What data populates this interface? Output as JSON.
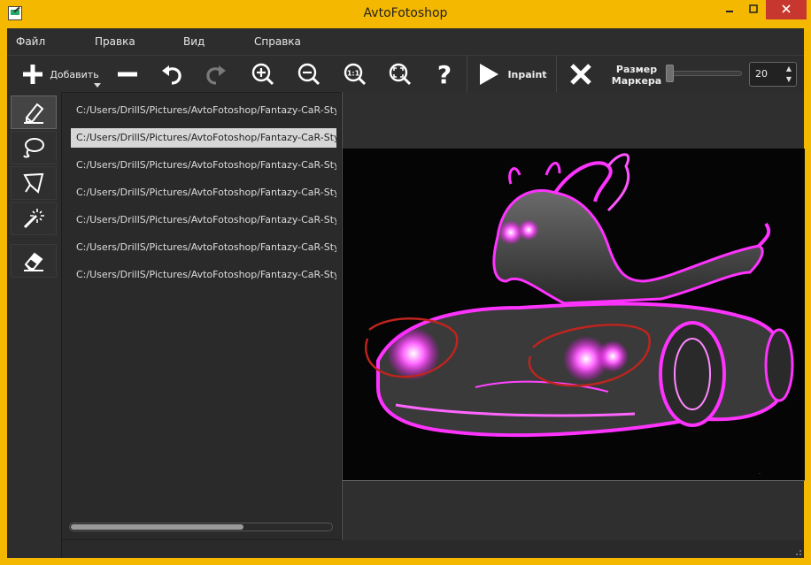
{
  "window": {
    "title": "AvtoFotoshop",
    "minimize_icon": "minimize-icon",
    "maximize_icon": "maximize-icon",
    "close_icon": "close-icon",
    "close_color": "#c7372f",
    "frame_color": "#f5b800"
  },
  "menu": {
    "items": [
      "Файл",
      "Правка",
      "Вид",
      "Справка"
    ]
  },
  "toolbar": {
    "add_label": "Добавить",
    "inpaint_label": "Inpaint",
    "marker_size_label_1": "Размер",
    "marker_size_label_2": "Маркера",
    "marker_size_value": "20",
    "icons": [
      "plus-icon",
      "minus-icon",
      "undo-icon",
      "redo-icon",
      "zoom-in-icon",
      "zoom-out-icon",
      "zoom-actual-icon",
      "zoom-fit-icon",
      "help-icon",
      "play-icon",
      "close-x-icon"
    ]
  },
  "tools": {
    "items": [
      "marker-icon",
      "lasso-icon",
      "polygon-lasso-icon",
      "magic-wand-icon",
      "eraser-icon"
    ],
    "active_index": 0
  },
  "files": {
    "items": [
      "C:/Users/DrillS/Pictures/AvtoFotoshop/Fantazy-CaR-Sty",
      "C:/Users/DrillS/Pictures/AvtoFotoshop/Fantazy-CaR-Sty",
      "C:/Users/DrillS/Pictures/AvtoFotoshop/Fantazy-CaR-Sty",
      "C:/Users/DrillS/Pictures/AvtoFotoshop/Fantazy-CaR-Sty",
      "C:/Users/DrillS/Pictures/AvtoFotoshop/Fantazy-CaR-Sty",
      "C:/Users/DrillS/Pictures/AvtoFotoshop/Fantazy-CaR-Sty",
      "C:/Users/DrillS/Pictures/AvtoFotoshop/Fantazy-CaR-Sty"
    ],
    "selected_index": 1
  },
  "canvas": {
    "accent_color": "#ff33ff",
    "marker_color": "#c0241e"
  }
}
